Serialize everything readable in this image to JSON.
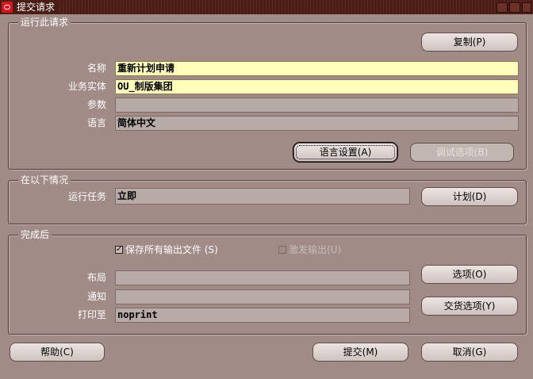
{
  "window": {
    "title": "提交请求"
  },
  "run_request": {
    "legend": "运行此请求",
    "copy_button": "复制(P)",
    "name_label": "名称",
    "name_value": "重新计划申请",
    "org_label": "业务实体",
    "org_value": "OU_制版集团",
    "params_label": "参数",
    "params_value": "",
    "language_label": "语言",
    "language_value": "简体中文",
    "language_settings_button": "语言设置(A)",
    "debug_options_button": "调试选项(B)"
  },
  "schedule": {
    "legend": "在以下情况",
    "run_job_label": "运行任务",
    "run_job_value": "立即",
    "schedule_button": "计划(D)"
  },
  "completion": {
    "legend": "完成后",
    "save_outputs_label": "保存所有输出文件 (S)",
    "save_outputs_checked": true,
    "burst_output_label": "激发输出(U)",
    "burst_output_checked": false,
    "layout_label": "布局",
    "layout_value": "",
    "notify_label": "通知",
    "notify_value": "",
    "print_to_label": "打印至",
    "print_to_value": "noprint",
    "options_button": "选项(O)",
    "delivery_options_button": "交货选项(Y)"
  },
  "footer": {
    "help_button": "帮助(C)",
    "submit_button": "提交(M)",
    "cancel_button": "取消(G)"
  },
  "colors": {
    "background": "#a08b87",
    "required_field": "#ffffbb",
    "titlebar": "#4a1c16"
  }
}
